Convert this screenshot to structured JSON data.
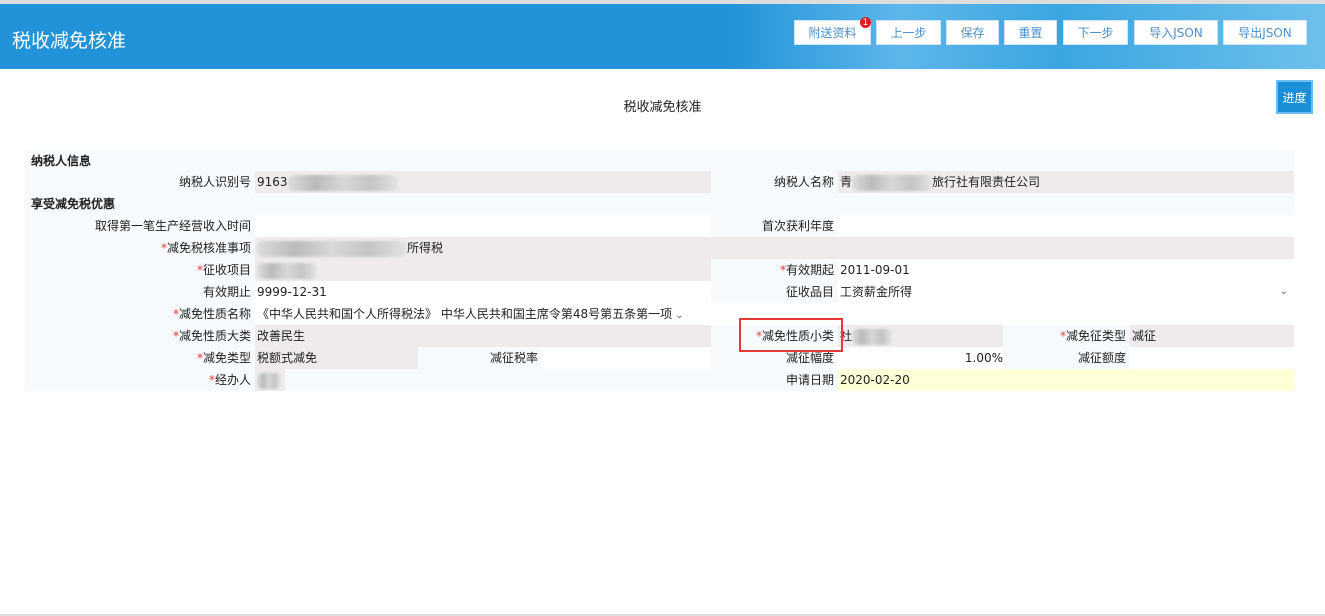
{
  "header": {
    "title": "税收减免核准",
    "buttons": [
      "附送资料",
      "上一步",
      "保存",
      "重置",
      "下一步",
      "导入JSON",
      "导出JSON"
    ],
    "badge_count": "1"
  },
  "page_title": "税收减免核准",
  "progress_label": "进度",
  "sections": {
    "taxpayer": "纳税人信息",
    "preference": "享受减免税优惠"
  },
  "fields": {
    "taxpayer_id": {
      "label": "纳税人识别号",
      "value": "9163"
    },
    "taxpayer_name": {
      "label": "纳税人名称",
      "value_prefix": "青",
      "value": "旅行社有限责任公司"
    },
    "first_income_time": {
      "label": "取得第一笔生产经营收入时间",
      "value": ""
    },
    "first_profit_year": {
      "label": "首次获利年度",
      "value": ""
    },
    "approval_item": {
      "label": "减免税核准事项",
      "value": "所得税"
    },
    "levy_item": {
      "label": "征收项目",
      "value": ""
    },
    "valid_from": {
      "label": "有效期起",
      "value": "2011-09-01"
    },
    "valid_to": {
      "label": "有效期止",
      "value": "9999-12-31"
    },
    "levy_subitem": {
      "label": "征收品目",
      "value": "工资薪金所得"
    },
    "nature_name": {
      "label": "减免性质名称",
      "value": "《中华人民共和国个人所得税法》 中华人民共和国主席令第48号第五条第一项"
    },
    "nature_major": {
      "label": "减免性质大类",
      "value": "改善民生"
    },
    "nature_minor": {
      "label": "减免性质小类",
      "value": "社"
    },
    "levy_type": {
      "label": "减免征类型",
      "value": "减征"
    },
    "relief_type": {
      "label": "减免类型",
      "value": "税额式减免"
    },
    "levy_rate": {
      "label": "减征税率",
      "value": ""
    },
    "levy_range": {
      "label": "减征幅度",
      "value": "1.00%"
    },
    "levy_amount": {
      "label": "减征额度",
      "value": ""
    },
    "handler": {
      "label": "经办人",
      "value": ""
    },
    "apply_date": {
      "label": "申请日期",
      "value": "2020-02-20"
    }
  },
  "required_mark": "*",
  "colors": {
    "header": "#2293d8",
    "highlight": "#e53935",
    "readonly": "#efebed",
    "date": "#ffffd8"
  }
}
